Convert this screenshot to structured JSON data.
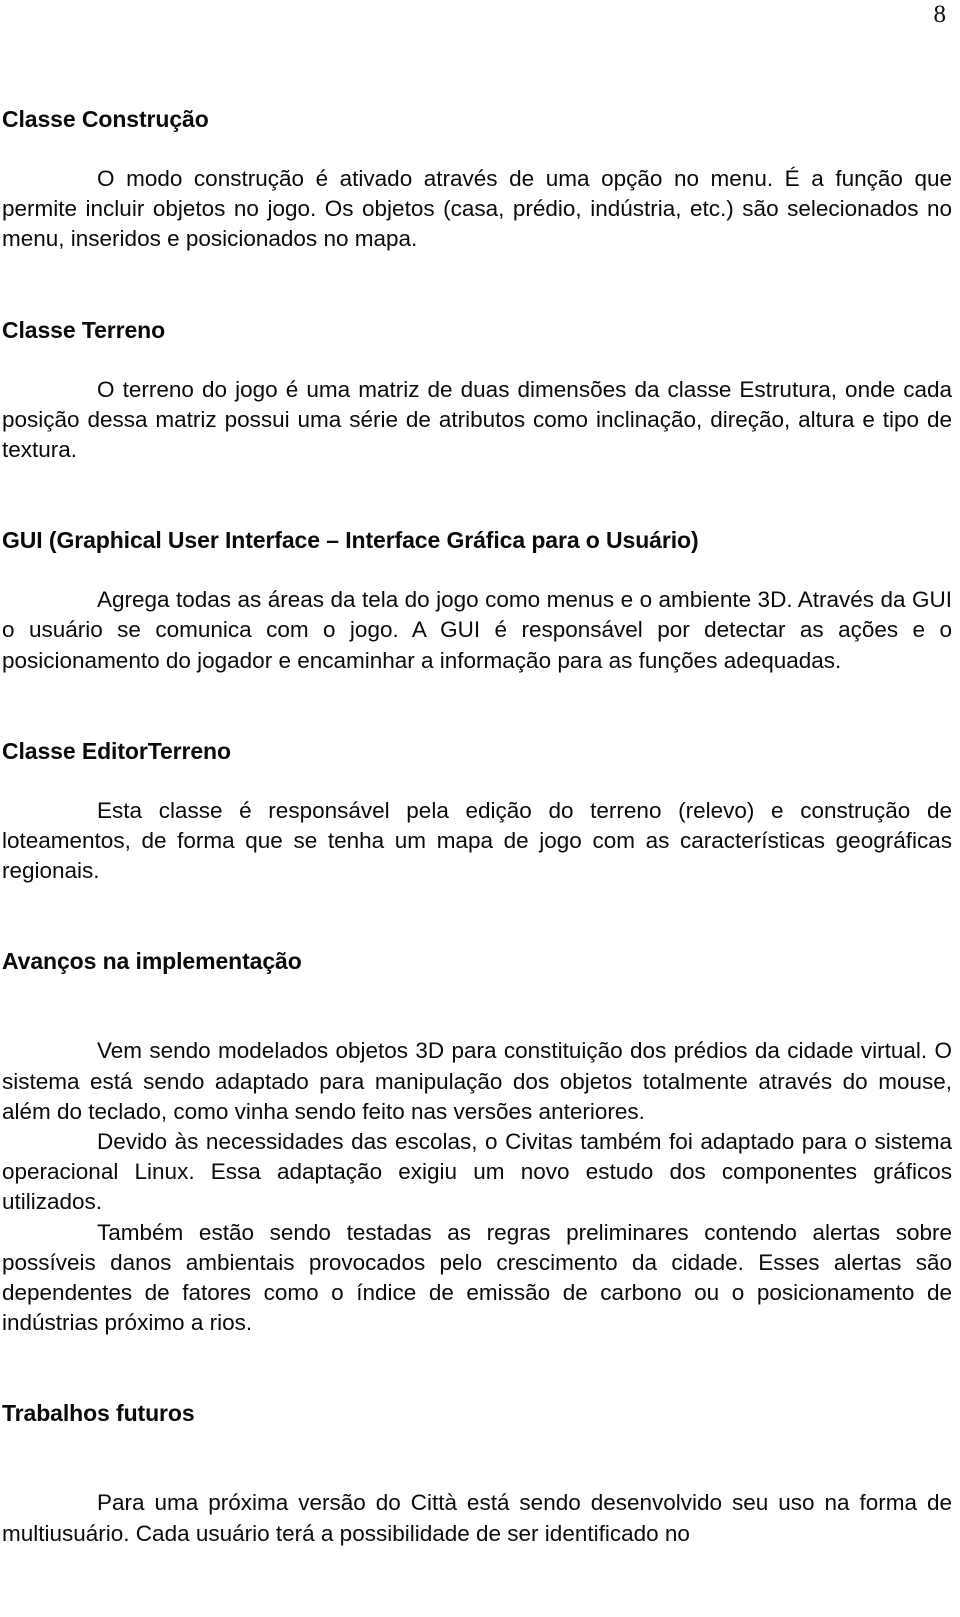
{
  "page": {
    "number": "8"
  },
  "sections": [
    {
      "heading": "Classe Construção",
      "paragraphs": [
        "O modo construção é ativado através de uma opção no menu. É a função que permite incluir objetos no jogo. Os objetos (casa, prédio, indústria, etc.) são selecionados no menu, inseridos e posicionados no mapa."
      ]
    },
    {
      "heading": "Classe Terreno",
      "paragraphs": [
        "O terreno do jogo é uma matriz de duas dimensões da classe Estrutura, onde cada posição dessa matriz possui uma série de atributos como inclinação, direção, altura e tipo de textura."
      ]
    },
    {
      "heading": "GUI (Graphical User Interface – Interface Gráfica para o Usuário)",
      "paragraphs": [
        "Agrega todas as áreas da tela do jogo como menus e o ambiente 3D. Através da GUI o usuário se comunica com o jogo. A GUI é responsável por detectar as ações e o posicionamento do jogador e encaminhar a informação para as funções adequadas."
      ]
    },
    {
      "heading": "Classe EditorTerreno",
      "paragraphs": [
        "Esta classe é responsável pela edição do terreno (relevo) e construção de loteamentos, de forma que se tenha um mapa de jogo com as características geográficas regionais."
      ]
    },
    {
      "heading": "Avanços na implementação",
      "paragraphs": [
        "Vem sendo modelados objetos 3D para constituição dos prédios da cidade virtual. O sistema está sendo adaptado para manipulação dos objetos totalmente através do mouse, além do teclado, como vinha sendo feito nas versões anteriores.",
        "Devido às necessidades das escolas, o Civitas também foi adaptado para o sistema operacional Linux. Essa adaptação exigiu um novo estudo dos componentes gráficos utilizados.",
        "Também estão sendo testadas as regras preliminares contendo alertas sobre possíveis danos ambientais provocados pelo crescimento da cidade. Esses alertas são dependentes de fatores como o índice de emissão de carbono ou o posicionamento de indústrias próximo a rios."
      ]
    },
    {
      "heading": "Trabalhos futuros",
      "paragraphs": [
        "Para uma próxima versão do Città está sendo desenvolvido seu uso na forma de multiusuário. Cada usuário terá a possibilidade de ser identificado no"
      ]
    }
  ]
}
